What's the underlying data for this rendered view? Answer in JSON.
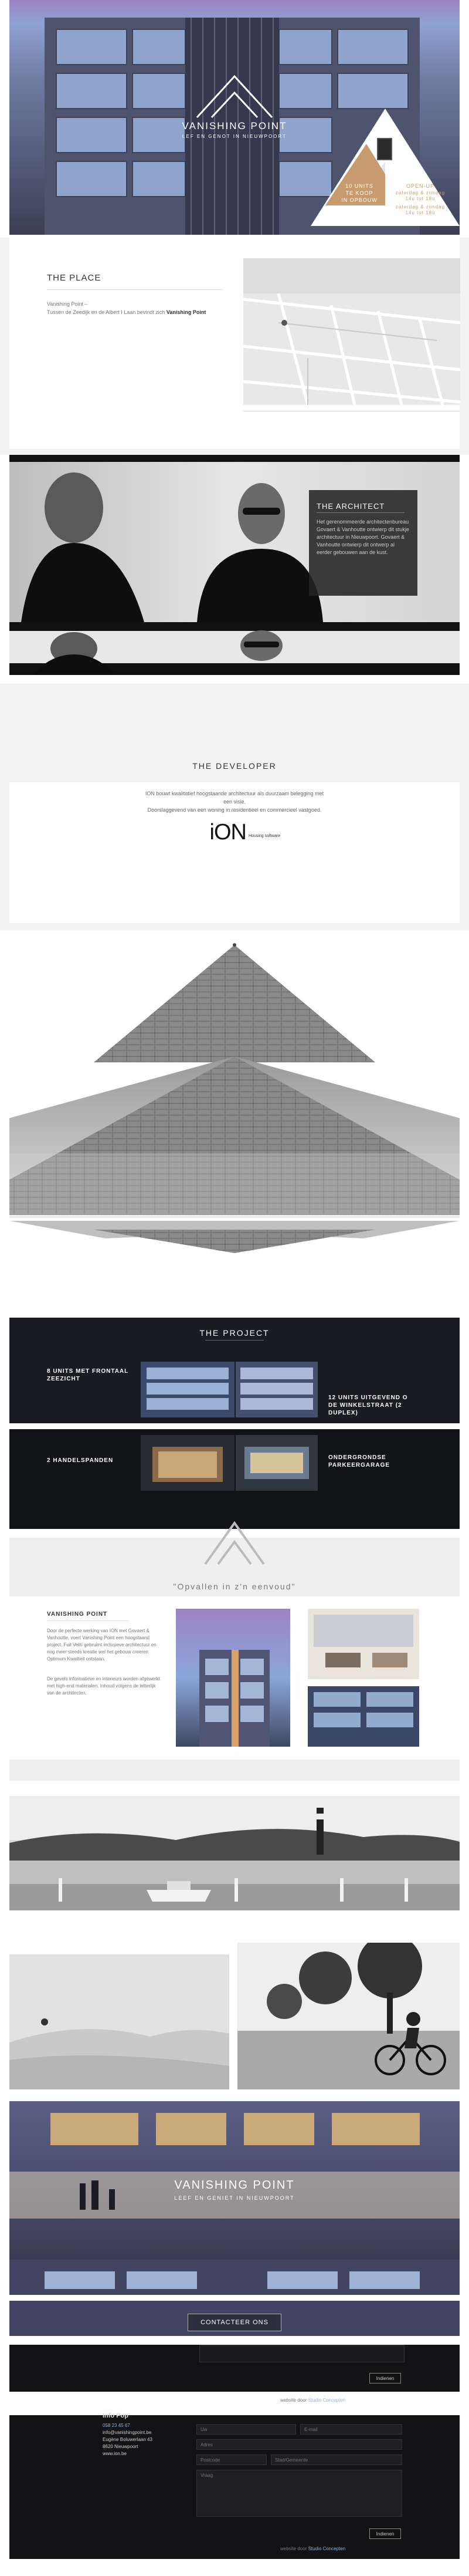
{
  "hero": {
    "brand": "VANISHING POINT",
    "subtitle": "LEF EN GENOT IN NIEUWPOORT",
    "promo_left_line1": "10 UNITS",
    "promo_left_line2": "TE KOOP",
    "promo_left_line3": "IN OPBOUW",
    "promo_right_line1": "OPEN-UP",
    "promo_right_line2": "zaterdag & zondag",
    "promo_right_line3": "14u tot 18u",
    "promo_right_line4": "zaterdag & zondag",
    "promo_right_line5": "14u tot 18u"
  },
  "place": {
    "title": "THE PLACE",
    "line1": "Vanishing Point –",
    "line2_prefix": "Tussen de Zeedijk en de Albert I Laan bevindt zich",
    "line2_strong": "Vanishing Point"
  },
  "architect": {
    "title": "THE ARCHITECT",
    "body": "Het gerenommeerde architectenbureau Govaert & Vanhoutte ontwierp dit stukje architectuur in Nieuwpoort. Govaert & Vanhoutte ontwierp dit ontwerp al eerder gebouwen aan de kust."
  },
  "developer": {
    "title": "THE DEVELOPER",
    "body_line1": "ION bouwt kwalitatief hoogstaande architectuur als duurzaam belegging met",
    "body_line2": "een visie.",
    "body_line3": "Doorslaggevend van een woning in residentieel en commercieel vastgoed.",
    "logo": "iON",
    "logo_tag": "Housing software"
  },
  "project": {
    "title": "THE PROJECT",
    "f1": "8 UNITS MET FRONTAAL ZEEZICHT",
    "f2": "12 UNITS UITGEVEND O DE WINKELSTRAAT (2 DUPLEX)",
    "f3": "2 HANDELSPANDEN",
    "f4": "ONDERGRONDSE PARKEERGARAGE"
  },
  "slogan": {
    "text": "\"Opvallen in z'n eenvoud\""
  },
  "vp": {
    "title": "VANISHING POINT",
    "p1": "Door de perfecte werking van ION met Govaert & Vanhoutte, voert Vanishing Point een hoogstaand project. Fuit Veliti gebruimt inclusieve architectuur en nog meer steeds kreatie wel het gebouw creeren Optimum Kwaliteit ontstaan.",
    "p2": "De gevels informatieve en interieurs worden afgewerkt met high-end materialen. Inhoud volgens de letterlijk van de architecten."
  },
  "contact_banner": {
    "brand": "VANISHING POINT",
    "subtitle": "LEEF EN GENIET IN NIEUWPOORT",
    "cta": "CONTACTEER ONS"
  },
  "footer1": {
    "submit": "Indienen",
    "credit_prefix": "website door",
    "credit_link": "Studio Concepten"
  },
  "footer2": {
    "heading": "Info Pop",
    "phone": "058 23 45 67",
    "email": "info@vanishingpoint.be",
    "street": "Eugène Boluwerlaan 43",
    "city": "8620 Nieuwpoort",
    "site": "www.ion.be",
    "placeholder_name": "Uw",
    "placeholder_email": "E-mail",
    "placeholder_address": "Adres",
    "placeholder_postal": "Postcode",
    "placeholder_city": "Stad/Gemeente",
    "placeholder_message": "Vraag",
    "submit": "Indienen",
    "credit_prefix": "website door",
    "credit_link": "Studio Concepten"
  }
}
